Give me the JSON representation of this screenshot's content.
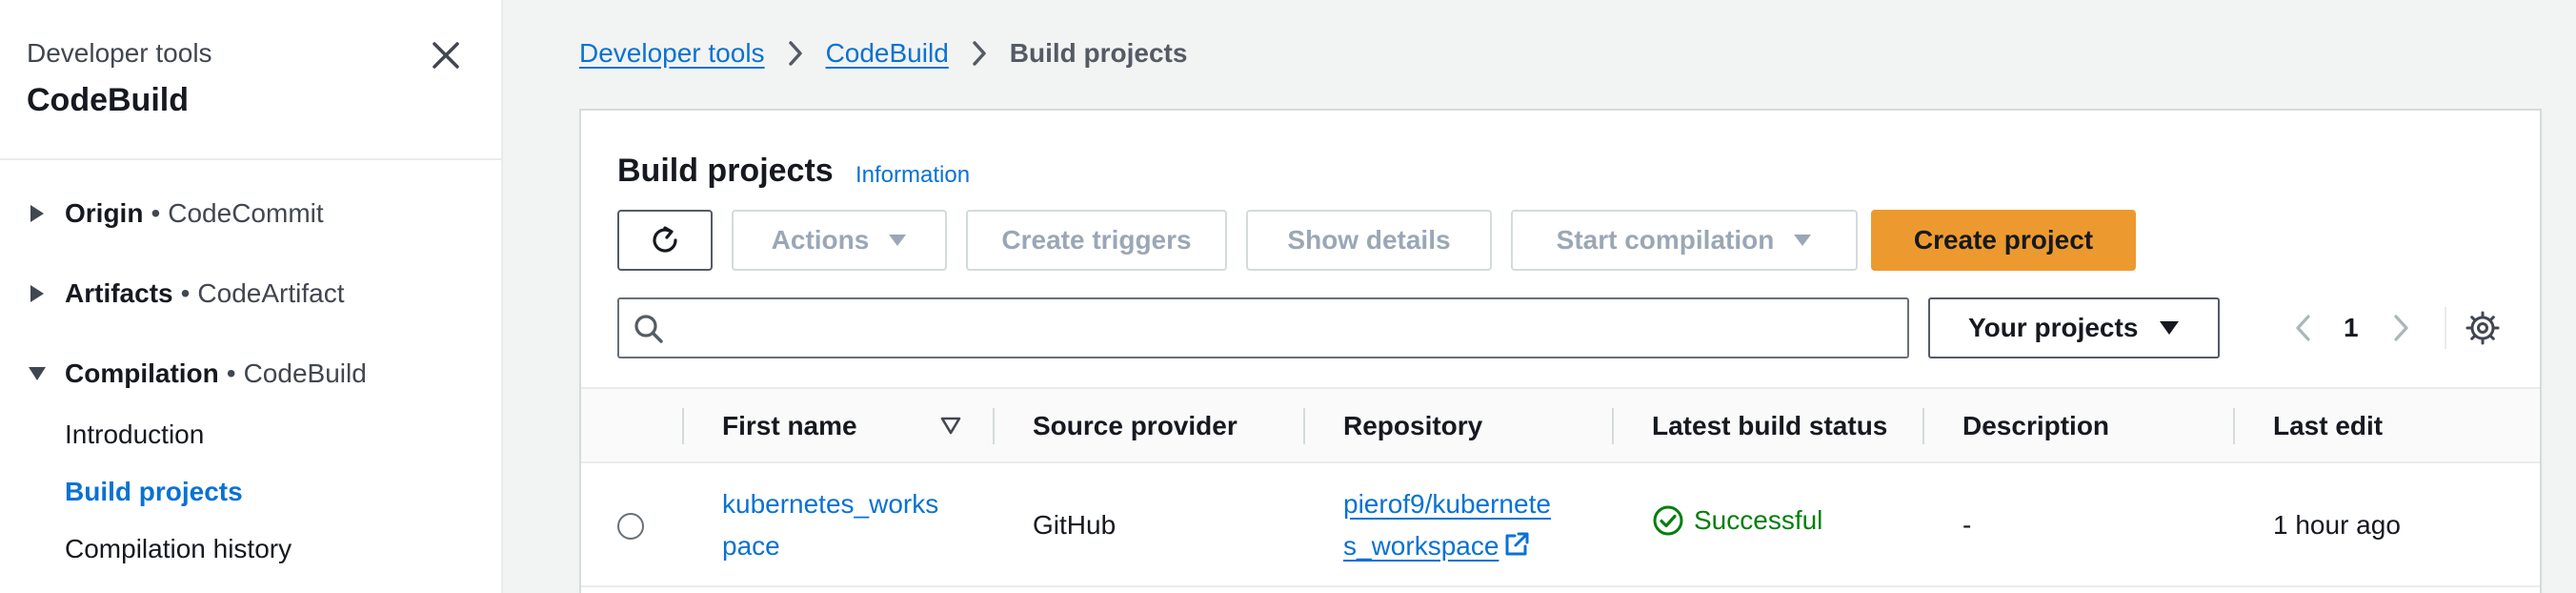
{
  "sidebar": {
    "service_label": "Developer tools",
    "title": "CodeBuild",
    "sections": [
      {
        "name": "Origin",
        "service": "CodeCommit",
        "expanded": false
      },
      {
        "name": "Artifacts",
        "service": "CodeArtifact",
        "expanded": false
      },
      {
        "name": "Compilation",
        "service": "CodeBuild",
        "expanded": true
      }
    ],
    "separator": "•",
    "items": [
      {
        "label": "Introduction",
        "active": false
      },
      {
        "label": "Build projects",
        "active": true
      },
      {
        "label": "Compilation history",
        "active": false
      }
    ]
  },
  "breadcrumb": {
    "items": [
      "Developer tools",
      "CodeBuild"
    ],
    "current": "Build projects"
  },
  "panel": {
    "title": "Build projects",
    "info_label": "Information"
  },
  "toolbar": {
    "actions_label": "Actions",
    "create_triggers_label": "Create triggers",
    "show_details_label": "Show details",
    "start_compilation_label": "Start compilation",
    "create_project_label": "Create project"
  },
  "filters": {
    "search_placeholder": "",
    "search_value": "",
    "projects_select": "Your projects"
  },
  "pagination": {
    "current_page": "1"
  },
  "table": {
    "columns": [
      "First name",
      "Source provider",
      "Repository",
      "Latest build status",
      "Description",
      "Last edit"
    ],
    "rows": [
      {
        "name_line1": "kubernetes_works",
        "name_line2": "pace",
        "source": "GitHub",
        "repo_line1": "pierof9/kubernete",
        "repo_line2": "s_workspace",
        "status": "Successful",
        "description": "-",
        "last_edit": "1 hour ago"
      }
    ]
  },
  "colors": {
    "link": "#0972d3",
    "primary_button": "#ec9a2f",
    "success": "#037f0c",
    "disabled_text": "#9ba7b6"
  },
  "icons": [
    "close-icon",
    "caret-right-icon",
    "caret-down-icon",
    "chevron-right-icon",
    "refresh-icon",
    "dropdown-caret-icon",
    "search-icon",
    "chevron-left-icon",
    "settings-icon",
    "sort-descending-icon",
    "external-link-icon",
    "check-circle-icon"
  ]
}
